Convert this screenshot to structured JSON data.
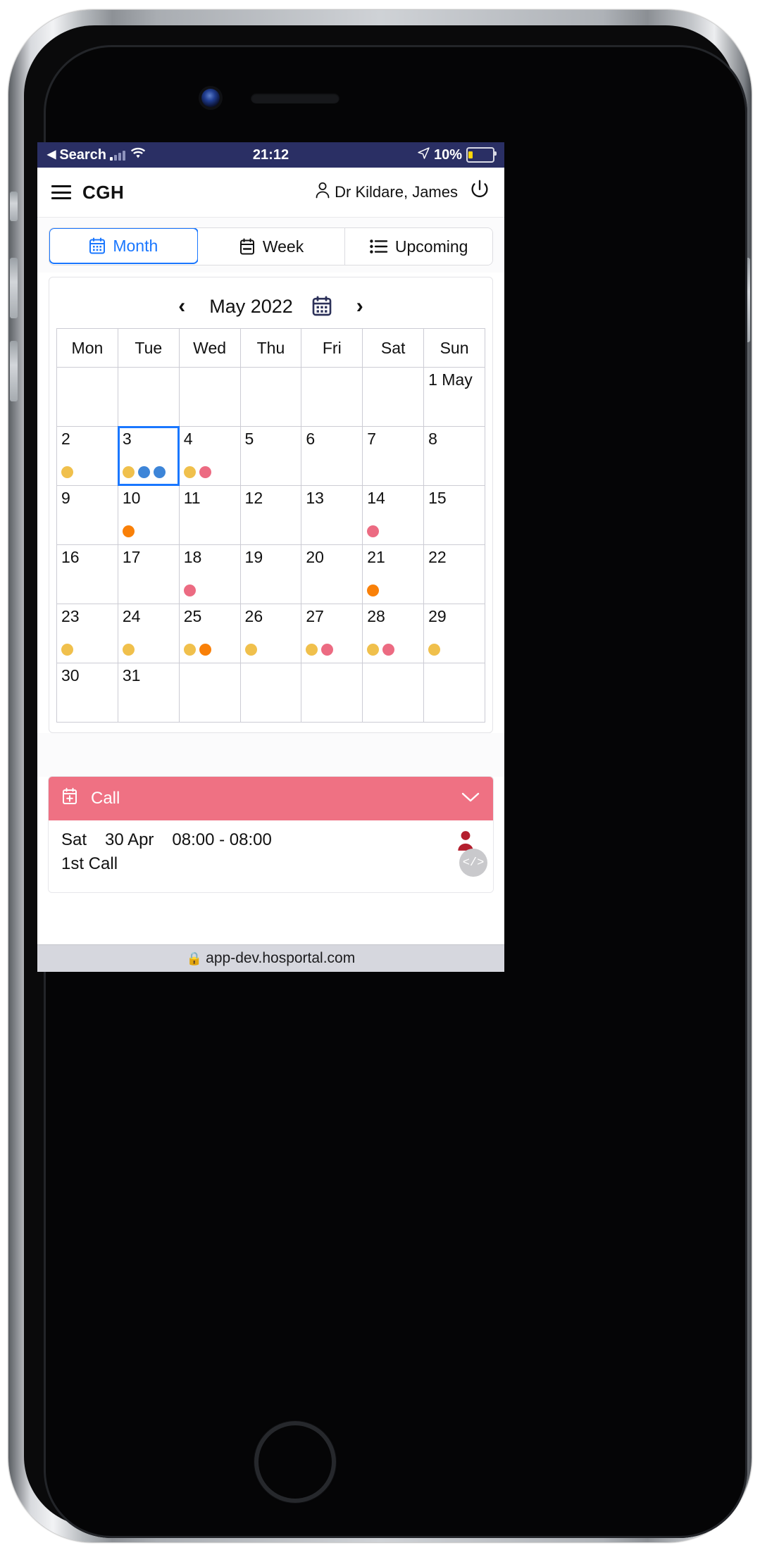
{
  "status_bar": {
    "back_label": "Search",
    "back_arrow": "back-triangle-icon",
    "signal_icon": "cellular-signal-icon",
    "wifi_icon": "wifi-icon",
    "time": "21:12",
    "location_icon": "location-arrow-icon",
    "battery_percent": "10%",
    "battery_icon": "battery-low-icon",
    "bg_color": "#2a2f64"
  },
  "app_header": {
    "menu_icon": "hamburger-menu-icon",
    "brand": "CGH",
    "user_icon": "person-icon",
    "user_name": "Dr Kildare, James",
    "logout_icon": "power-icon"
  },
  "tabs": [
    {
      "label": "Month",
      "icon": "calendar-month-icon",
      "active": true
    },
    {
      "label": "Week",
      "icon": "calendar-week-icon",
      "active": false
    },
    {
      "label": "Upcoming",
      "icon": "list-icon",
      "active": false
    }
  ],
  "calendar": {
    "prev_icon": "chevron-left-icon",
    "next_icon": "chevron-right-icon",
    "picker_icon": "calendar-picker-icon",
    "month_label": "May 2022",
    "weekdays": [
      "Mon",
      "Tue",
      "Wed",
      "Thu",
      "Fri",
      "Sat",
      "Sun"
    ],
    "legend_colors": {
      "yellow": "#f0c04c",
      "orange": "#f98008",
      "blue": "#3d85d8",
      "pink": "#ec6b82"
    },
    "weeks": [
      [
        {
          "day": "",
          "blank": true,
          "weekend": false,
          "selected": false,
          "dots": []
        },
        {
          "day": "",
          "blank": true,
          "weekend": false,
          "selected": false,
          "dots": []
        },
        {
          "day": "",
          "blank": true,
          "weekend": false,
          "selected": false,
          "dots": []
        },
        {
          "day": "",
          "blank": true,
          "weekend": false,
          "selected": false,
          "dots": []
        },
        {
          "day": "",
          "blank": true,
          "weekend": false,
          "selected": false,
          "dots": []
        },
        {
          "day": "",
          "blank": true,
          "weekend": true,
          "selected": false,
          "dots": []
        },
        {
          "day": "1 May",
          "blank": false,
          "weekend": true,
          "selected": false,
          "dots": []
        }
      ],
      [
        {
          "day": "2",
          "blank": false,
          "weekend": false,
          "selected": false,
          "dots": [
            "yellow"
          ]
        },
        {
          "day": "3",
          "blank": false,
          "weekend": false,
          "selected": true,
          "dots": [
            "yellow",
            "blue",
            "blue"
          ]
        },
        {
          "day": "4",
          "blank": false,
          "weekend": false,
          "selected": false,
          "dots": [
            "yellow",
            "pink"
          ]
        },
        {
          "day": "5",
          "blank": false,
          "weekend": false,
          "selected": false,
          "dots": []
        },
        {
          "day": "6",
          "blank": false,
          "weekend": false,
          "selected": false,
          "dots": []
        },
        {
          "day": "7",
          "blank": false,
          "weekend": true,
          "selected": false,
          "dots": []
        },
        {
          "day": "8",
          "blank": false,
          "weekend": true,
          "selected": false,
          "dots": []
        }
      ],
      [
        {
          "day": "9",
          "blank": false,
          "weekend": false,
          "selected": false,
          "dots": []
        },
        {
          "day": "10",
          "blank": false,
          "weekend": false,
          "selected": false,
          "dots": [
            "orange"
          ]
        },
        {
          "day": "11",
          "blank": false,
          "weekend": false,
          "selected": false,
          "dots": []
        },
        {
          "day": "12",
          "blank": false,
          "weekend": false,
          "selected": false,
          "dots": []
        },
        {
          "day": "13",
          "blank": false,
          "weekend": false,
          "selected": false,
          "dots": []
        },
        {
          "day": "14",
          "blank": false,
          "weekend": true,
          "selected": false,
          "dots": [
            "pink"
          ]
        },
        {
          "day": "15",
          "blank": false,
          "weekend": true,
          "selected": false,
          "dots": []
        }
      ],
      [
        {
          "day": "16",
          "blank": false,
          "weekend": false,
          "selected": false,
          "dots": []
        },
        {
          "day": "17",
          "blank": false,
          "weekend": false,
          "selected": false,
          "dots": []
        },
        {
          "day": "18",
          "blank": false,
          "weekend": false,
          "selected": false,
          "dots": [
            "pink"
          ]
        },
        {
          "day": "19",
          "blank": false,
          "weekend": false,
          "selected": false,
          "dots": []
        },
        {
          "day": "20",
          "blank": false,
          "weekend": false,
          "selected": false,
          "dots": []
        },
        {
          "day": "21",
          "blank": false,
          "weekend": true,
          "selected": false,
          "dots": [
            "orange"
          ]
        },
        {
          "day": "22",
          "blank": false,
          "weekend": true,
          "selected": false,
          "dots": []
        }
      ],
      [
        {
          "day": "23",
          "blank": false,
          "weekend": false,
          "selected": false,
          "dots": [
            "yellow"
          ]
        },
        {
          "day": "24",
          "blank": false,
          "weekend": false,
          "selected": false,
          "dots": [
            "yellow"
          ]
        },
        {
          "day": "25",
          "blank": false,
          "weekend": false,
          "selected": false,
          "dots": [
            "yellow",
            "orange"
          ]
        },
        {
          "day": "26",
          "blank": false,
          "weekend": false,
          "selected": false,
          "dots": [
            "yellow"
          ]
        },
        {
          "day": "27",
          "blank": false,
          "weekend": false,
          "selected": false,
          "dots": [
            "yellow",
            "pink"
          ]
        },
        {
          "day": "28",
          "blank": false,
          "weekend": true,
          "selected": false,
          "dots": [
            "yellow",
            "pink"
          ]
        },
        {
          "day": "29",
          "blank": false,
          "weekend": true,
          "selected": false,
          "dots": [
            "yellow"
          ]
        }
      ],
      [
        {
          "day": "30",
          "blank": false,
          "weekend": false,
          "selected": false,
          "dots": []
        },
        {
          "day": "31",
          "blank": false,
          "weekend": false,
          "selected": false,
          "dots": []
        },
        {
          "day": "",
          "blank": true,
          "weekend": false,
          "selected": false,
          "dots": []
        },
        {
          "day": "",
          "blank": true,
          "weekend": false,
          "selected": false,
          "dots": []
        },
        {
          "day": "",
          "blank": true,
          "weekend": false,
          "selected": false,
          "dots": []
        },
        {
          "day": "",
          "blank": true,
          "weekend": true,
          "selected": false,
          "dots": []
        },
        {
          "day": "",
          "blank": true,
          "weekend": true,
          "selected": false,
          "dots": []
        }
      ]
    ]
  },
  "event_card": {
    "header_icon": "calendar-plus-icon",
    "header_title": "Call",
    "collapse_icon": "chevron-down-icon",
    "header_color": "#ef7183",
    "weekday": "Sat",
    "date": "30 Apr",
    "time_range": "08:00 - 08:00",
    "subtitle": "1st Call",
    "person_icon": "person-filled-icon",
    "person_color": "#b41f2e",
    "code_icon": "code-icon"
  },
  "browser": {
    "lock_icon": "lock-icon",
    "url": "app-dev.hosportal.com"
  }
}
